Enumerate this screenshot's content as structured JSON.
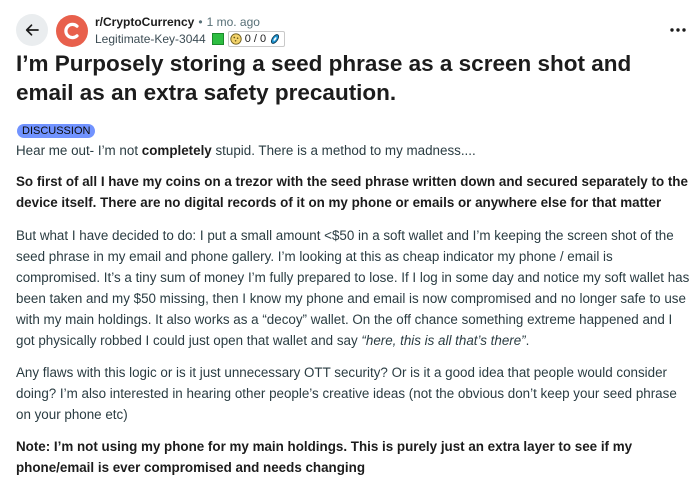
{
  "header": {
    "subreddit": "r/CryptoCurrency",
    "separator": "•",
    "age": "1 mo. ago",
    "author": "Legitimate-Key-3044",
    "flair_text": "0 / 0",
    "subreddit_color": "#e8604c"
  },
  "post": {
    "title": "I’m Purposely storing a seed phrase as a screen shot and email as an extra safety precaution.",
    "flair": "DISCUSSION",
    "flair_color": "#7193ff",
    "p1_a": "Hear me out- I’m not ",
    "p1_b": "completely",
    "p1_c": " stupid. There is a method to my madness....",
    "p2": "So first of all I have my coins on a trezor with the seed phrase written down and secured separately to the device itself. There are no digital records of it on my phone or emails or anywhere else for that matter",
    "p3_a": "But what I have decided to do: I put a small amount <$50 in a soft wallet and I’m keeping the screen shot of the seed phrase in my email and phone gallery. I’m looking at this as cheap indicator my phone / email is compromised. It’s a tiny sum of money I’m fully prepared to lose. If I log in some day and notice my soft wallet has been taken and my $50 missing, then I know my phone and email is now compromised and no longer safe to use with my main holdings. It also works as a “decoy” wallet. On the off chance something extreme happened and I got physically robbed I could just open that wallet and say ",
    "p3_b": "“here, this is all that’s there”",
    "p3_c": ".",
    "p4": "Any flaws with this logic or is it just unnecessary OTT security? Or is it a good idea that people would consider doing? I’m also interested in hearing other people’s creative ideas (not the obvious don’t keep your seed phrase on your phone etc)",
    "p5": "Note: I’m not using my phone for my main holdings. This is purely just an extra layer to see if my phone/email is ever compromised and needs changing"
  }
}
